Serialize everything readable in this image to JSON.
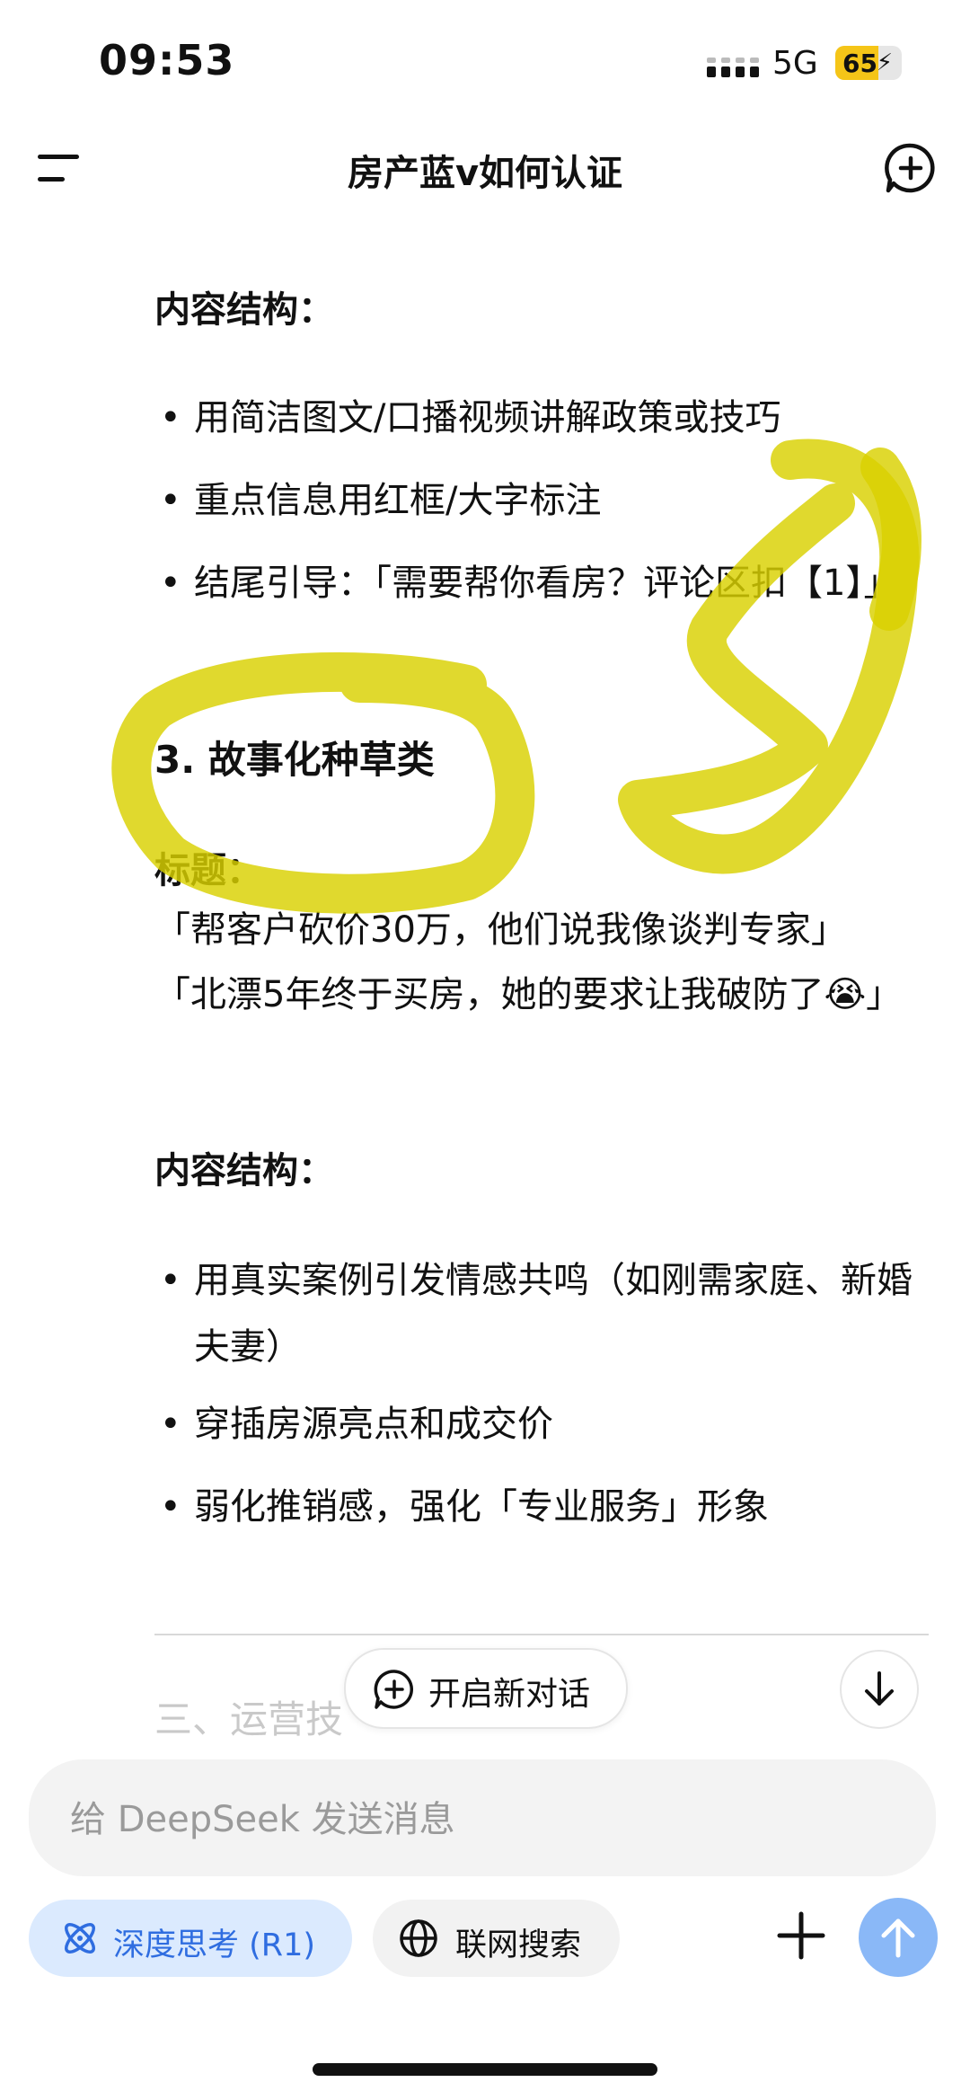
{
  "status_bar": {
    "time": "09:53",
    "network": "5G",
    "battery": "65",
    "battery_level": 0.65
  },
  "header": {
    "title": "房产蓝v如何认证",
    "menu_icon": "menu-icon",
    "new_chat_icon": "new-chat-plus-icon"
  },
  "content": {
    "section1_structure_heading": "内容结构：",
    "section1_bullets": [
      "用简洁图文/口播视频讲解政策或技巧",
      "重点信息用红框/大字标注",
      "结尾引导：「需要帮你看房？评论区扣【1】」"
    ],
    "section3_heading": "3. 故事化种草类",
    "title_label": "标题：",
    "title_line1": "「帮客户砍价30万，他们说我像谈判专家」",
    "title_line2": "「北漂5年终于买房，她的要求让我破防了😭」",
    "section3_structure_heading": "内容结构：",
    "section3_bullets": [
      "用真实案例引发情感共鸣（如刚需家庭、新婚夫妻）",
      "穿插房源亮点和成交价",
      "弱化推销感，强化「专业服务」形象"
    ],
    "faded_next_heading": "三、运营技"
  },
  "floating": {
    "new_chat_label": "开启新对话",
    "scroll_down_icon": "arrow-down-icon"
  },
  "composer": {
    "placeholder": "给 DeepSeek 发送消息",
    "deep_think_label": "深度思考 (R1)",
    "web_search_label": "联网搜索",
    "accent_color": "#2f6de0",
    "send_color": "#8ab8f7"
  }
}
